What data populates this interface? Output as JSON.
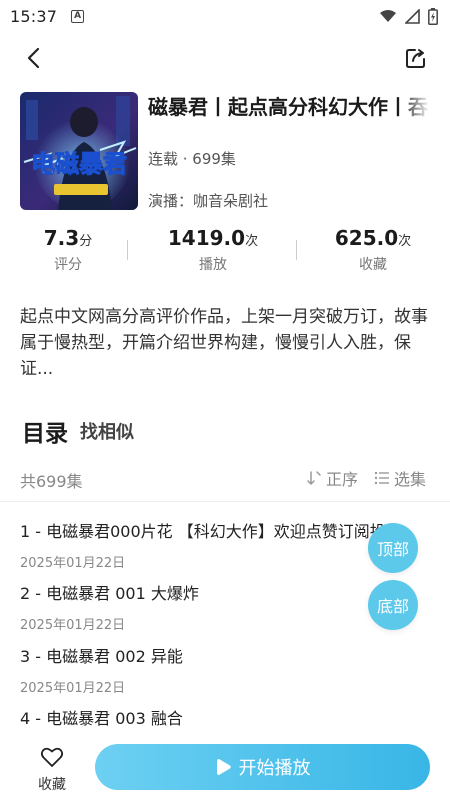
{
  "status_bar": {
    "time": "15:37",
    "notification_icon": "a-icon",
    "icons": [
      "wifi-icon",
      "signal-icon",
      "battery-icon"
    ]
  },
  "nav": {
    "back_icon": "chevron-left-icon",
    "share_icon": "share-icon"
  },
  "album": {
    "title": "磁暴君丨起点高分科幻大作丨吞",
    "meta": "连载 · 699集",
    "cast": "演播：咖音朵剧社",
    "cover_text": "电磁暴君"
  },
  "stats": [
    {
      "value": "7.3",
      "unit": "分",
      "label": "评分"
    },
    {
      "value": "1419.0",
      "unit": "次",
      "label": "播放"
    },
    {
      "value": "625.0",
      "unit": "次",
      "label": "收藏"
    }
  ],
  "description": "起点中文网高分高评价作品，上架一月突破万订，故事属于慢热型，开篇介绍世界构建，慢慢引人入胜，保证...",
  "catalog": {
    "title": "目录",
    "similar": "找相似",
    "count": "共699集",
    "order_label": "正序",
    "select_label": "选集"
  },
  "episodes": [
    {
      "title": "1 - 电磁暴君000片花 【科幻大作】欢迎点赞订阅投...",
      "date": "2025年01月22日"
    },
    {
      "title": "2 - 电磁暴君 001 大爆炸",
      "date": "2025年01月22日"
    },
    {
      "title": "3 - 电磁暴君 002 异能",
      "date": "2025年01月22日"
    },
    {
      "title": "4 - 电磁暴君 003 融合",
      "date": ""
    }
  ],
  "fab": {
    "top_label": "顶部",
    "bottom_label": "底部"
  },
  "bottom_bar": {
    "favorite_label": "收藏",
    "play_label": "开始播放"
  },
  "colors": {
    "accent": "#5cc8ea",
    "play_gradient_start": "#6dd0f2",
    "play_gradient_end": "#38b6e6"
  }
}
